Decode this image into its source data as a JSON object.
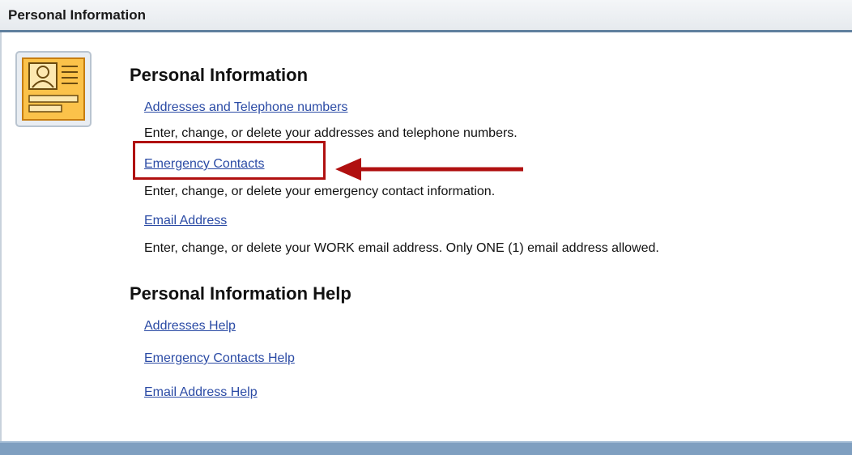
{
  "window": {
    "title": "Personal Information"
  },
  "personal_info": {
    "heading": "Personal Information",
    "items": [
      {
        "link": "Addresses and Telephone numbers",
        "description": "Enter, change, or delete your addresses and telephone numbers."
      },
      {
        "link": "Emergency Contacts",
        "description": "Enter, change, or delete your emergency contact information."
      },
      {
        "link": "Email Address",
        "description": "Enter, change, or delete your WORK email address.  Only ONE (1) email address allowed."
      }
    ]
  },
  "help": {
    "heading": "Personal Information Help",
    "links": [
      "Addresses Help",
      "Emergency Contacts Help",
      "Email Address Help"
    ]
  },
  "icons": {
    "section_icon": "contact-card-icon",
    "annotation_arrow": "arrow-left-icon"
  },
  "colors": {
    "link": "#2b4ba5",
    "highlight": "#b01010",
    "header_border": "#5f7f9e"
  }
}
